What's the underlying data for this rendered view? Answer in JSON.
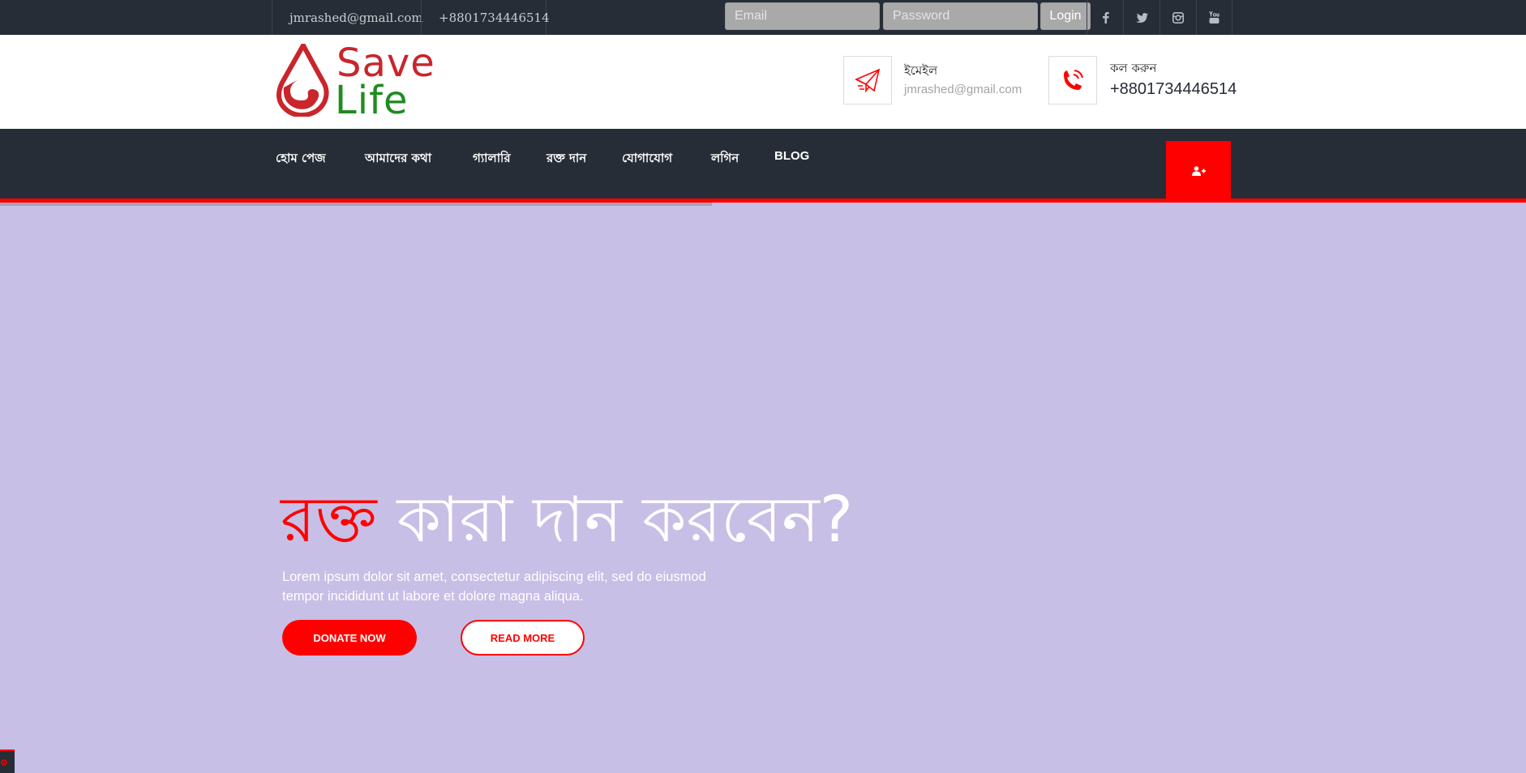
{
  "topbar": {
    "email": "jmrashed@gmail.com",
    "phone": "+8801734446514",
    "email_placeholder": "Email",
    "password_placeholder": "Password",
    "login_label": "Login",
    "social_icons": [
      "facebook-icon",
      "twitter-icon",
      "instagram-icon",
      "youtube-icon"
    ]
  },
  "logo": {
    "line1": "Save",
    "line2": "Life"
  },
  "header": {
    "email_title": "ইমেইল",
    "email_value": "jmrashed@gmail.com",
    "call_title": "কল করুন",
    "call_value": "+8801734446514"
  },
  "nav": {
    "items": [
      "হোম পেজ",
      "আমাদের কথা",
      "গ্যালারি",
      "রক্ত দান",
      "যোগাযোগ",
      "লগিন",
      "BLOG"
    ]
  },
  "hero": {
    "title_accent": "রক্ত",
    "title_rest": "কারা দান করবেন?",
    "text": "Lorem ipsum dolor sit amet, consectetur adipiscing elit, sed do eiusmod tempor incididunt ut labore et dolore magna aliqua.",
    "donate_label": "DONATE NOW",
    "read_label": "READ MORE"
  },
  "colors": {
    "accent": "#ff0000",
    "dark": "#262d36",
    "hero_bg": "#c7bfe6",
    "logo_red": "#c9252b",
    "logo_green": "#1f8c1f"
  }
}
